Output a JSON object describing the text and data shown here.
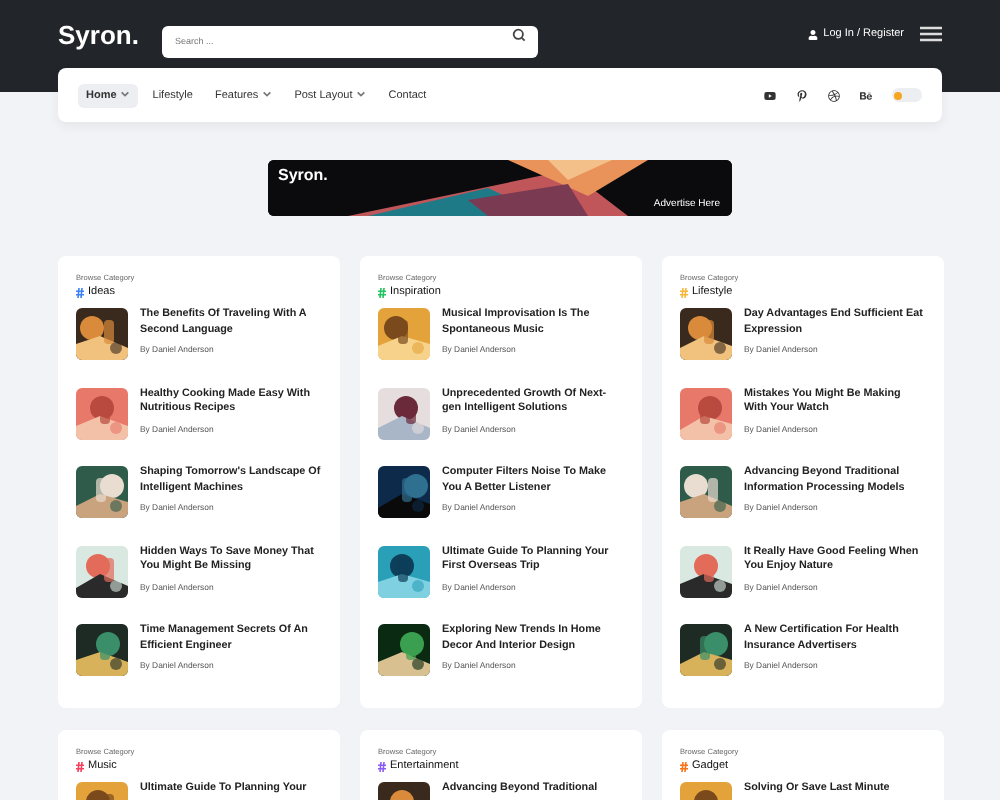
{
  "header": {
    "logo": "Syron.",
    "search": {
      "placeholder": "Search ..."
    },
    "login": "Log In / Register"
  },
  "nav": {
    "items": [
      {
        "label": "Home",
        "has_menu": true,
        "selected": true
      },
      {
        "label": "Lifestyle",
        "has_menu": false,
        "selected": false
      },
      {
        "label": "Features",
        "has_menu": true,
        "selected": false
      },
      {
        "label": "Post Layout",
        "has_menu": true,
        "selected": false
      },
      {
        "label": "Contact",
        "has_menu": false,
        "selected": false
      }
    ],
    "socials": [
      {
        "kind": "youtube"
      },
      {
        "kind": "pinterest"
      },
      {
        "kind": "dribbble"
      },
      {
        "kind": "behance"
      }
    ],
    "dark_mode": {
      "on": false
    }
  },
  "banner": {
    "logo": "Syron.",
    "cta": "Advertise Here"
  },
  "categories": [
    {
      "eyebrow": "Browse Category",
      "name": "Ideas",
      "color": "#3b82f6",
      "posts": [
        {
          "title": "The Benefits Of Traveling With A Second Language",
          "author": "By Daniel Anderson"
        },
        {
          "title": "Healthy Cooking Made Easy With Nutritious Recipes",
          "author": "By Daniel Anderson"
        },
        {
          "title": "Shaping Tomorrow's Landscape Of Intelligent Machines",
          "author": "By Daniel Anderson"
        },
        {
          "title": "Hidden Ways To Save Money That You Might Be Missing",
          "author": "By Daniel Anderson"
        },
        {
          "title": "Time Management Secrets Of An Efficient Engineer",
          "author": "By Daniel Anderson"
        }
      ]
    },
    {
      "eyebrow": "Browse Category",
      "name": "Inspiration",
      "color": "#22c55e",
      "posts": [
        {
          "title": "Musical Improvisation Is The Spontaneous Music",
          "author": "By Daniel Anderson"
        },
        {
          "title": "Unprecedented Growth Of Next-gen Intelligent Solutions",
          "author": "By Daniel Anderson"
        },
        {
          "title": "Computer Filters Noise To Make You A Better Listener",
          "author": "By Daniel Anderson"
        },
        {
          "title": "Ultimate Guide To Planning Your First Overseas Trip",
          "author": "By Daniel Anderson"
        },
        {
          "title": "Exploring New Trends In Home Decor And Interior Design",
          "author": "By Daniel Anderson"
        }
      ]
    },
    {
      "eyebrow": "Browse Category",
      "name": "Lifestyle",
      "color": "#f5b83d",
      "posts": [
        {
          "title": "Day Advantages End Sufficient Eat Expression",
          "author": "By Daniel Anderson"
        },
        {
          "title": "Mistakes You Might Be Making With Your Watch",
          "author": "By Daniel Anderson"
        },
        {
          "title": "Advancing Beyond Traditional Information Processing Models",
          "author": "By Daniel Anderson"
        },
        {
          "title": "It Really Have Good Feeling When You Enjoy Nature",
          "author": "By Daniel Anderson"
        },
        {
          "title": "A New Certification For Health Insurance Advertisers",
          "author": "By Daniel Anderson"
        }
      ]
    },
    {
      "eyebrow": "Browse Category",
      "name": "Music",
      "color": "#f43f5e",
      "posts": [
        {
          "title": "Ultimate Guide To Planning Your"
        }
      ]
    },
    {
      "eyebrow": "Browse Category",
      "name": "Entertainment",
      "color": "#8b5cf6",
      "posts": [
        {
          "title": "Advancing Beyond Traditional"
        }
      ]
    },
    {
      "eyebrow": "Browse Category",
      "name": "Gadget",
      "color": "#f97316",
      "posts": [
        {
          "title": "Solving Or Save Last Minute"
        }
      ]
    }
  ]
}
